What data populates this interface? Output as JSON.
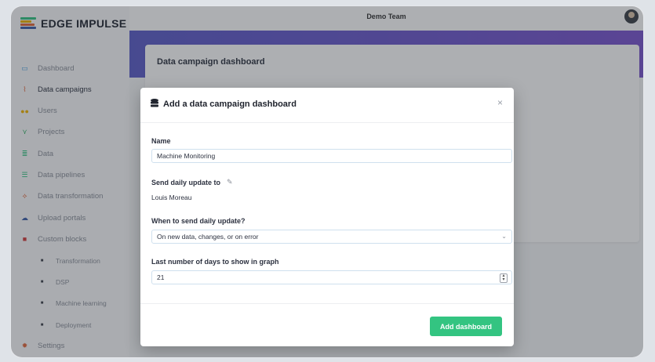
{
  "app": {
    "brand": "EDGE IMPULSE",
    "team": "Demo Team"
  },
  "colors": {
    "accent_green": "#33c481",
    "hero_start": "#5b5cc9",
    "hero_end": "#7a54cf",
    "input_border": "#cfe0ee"
  },
  "sidebar": {
    "items": [
      {
        "label": "Dashboard",
        "icon": "monitor-icon",
        "color": "#4aa3df"
      },
      {
        "label": "Data campaigns",
        "icon": "chart-icon",
        "color": "#e0663a",
        "active": true
      },
      {
        "label": "Users",
        "icon": "users-icon",
        "color": "#f0b400"
      },
      {
        "label": "Projects",
        "icon": "projects-icon",
        "color": "#3bb36b"
      },
      {
        "label": "Data",
        "icon": "database-icon",
        "color": "#33c481"
      },
      {
        "label": "Data pipelines",
        "icon": "pipelines-icon",
        "color": "#33c481"
      },
      {
        "label": "Data transformation",
        "icon": "pulse-icon",
        "color": "#e0663a"
      },
      {
        "label": "Upload portals",
        "icon": "cloud-upload-icon",
        "color": "#3d5ea8"
      },
      {
        "label": "Custom blocks",
        "icon": "cube-icon",
        "color": "#d23b3b"
      },
      {
        "label": "Transformation",
        "icon": "square-icon",
        "sub": true
      },
      {
        "label": "DSP",
        "icon": "square-icon",
        "sub": true
      },
      {
        "label": "Machine learning",
        "icon": "square-icon",
        "sub": true
      },
      {
        "label": "Deployment",
        "icon": "square-icon",
        "sub": true
      },
      {
        "label": "Settings",
        "icon": "gear-icon",
        "color": "#e0663a"
      }
    ]
  },
  "main": {
    "card_title": "Data campaign dashboard"
  },
  "modal": {
    "title": "Add a data campaign dashboard",
    "close": "×",
    "name_label": "Name",
    "name_value": "Machine Monitoring",
    "send_label": "Send daily update to",
    "send_value": "Louis Moreau",
    "when_label": "When to send daily update?",
    "when_value": "On new data, changes, or on error",
    "days_label": "Last number of days to show in graph",
    "days_value": "21",
    "submit": "Add dashboard"
  }
}
